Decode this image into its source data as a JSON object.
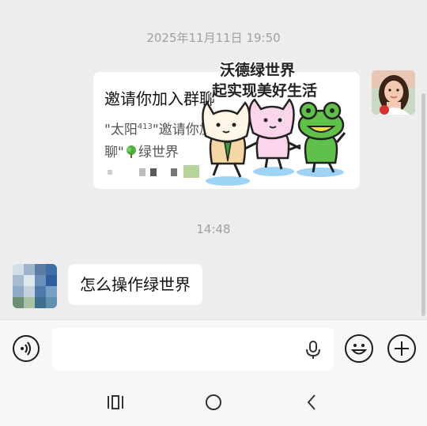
{
  "timestamps": {
    "first": "2025年11月11日 19:50",
    "second": "14:48"
  },
  "invite_card": {
    "title": "邀请你加入群聊",
    "body_line1_prefix": "\"太阳",
    "body_line1_sup": "413",
    "body_line1_suffix": "\"邀请你加入群",
    "body_line2_prefix": "聊\"",
    "body_line2_name": "绿世界"
  },
  "sticker": {
    "line1": "沃德绿世界",
    "line2": "起实现美好生活"
  },
  "incoming_message": {
    "text": "怎么操作绿世界"
  },
  "input": {
    "value": ""
  },
  "icons": {
    "voice": "voice-input-icon",
    "mic": "microphone-icon",
    "emoji": "emoji-icon",
    "plus": "plus-icon",
    "recents": "recent-apps-icon",
    "home": "home-icon",
    "back": "back-icon",
    "tree": "tree-icon"
  },
  "colors": {
    "background": "#ededed",
    "bubble": "#ffffff",
    "timestamp": "#a0a0a0",
    "bar": "#f7f7f7"
  }
}
